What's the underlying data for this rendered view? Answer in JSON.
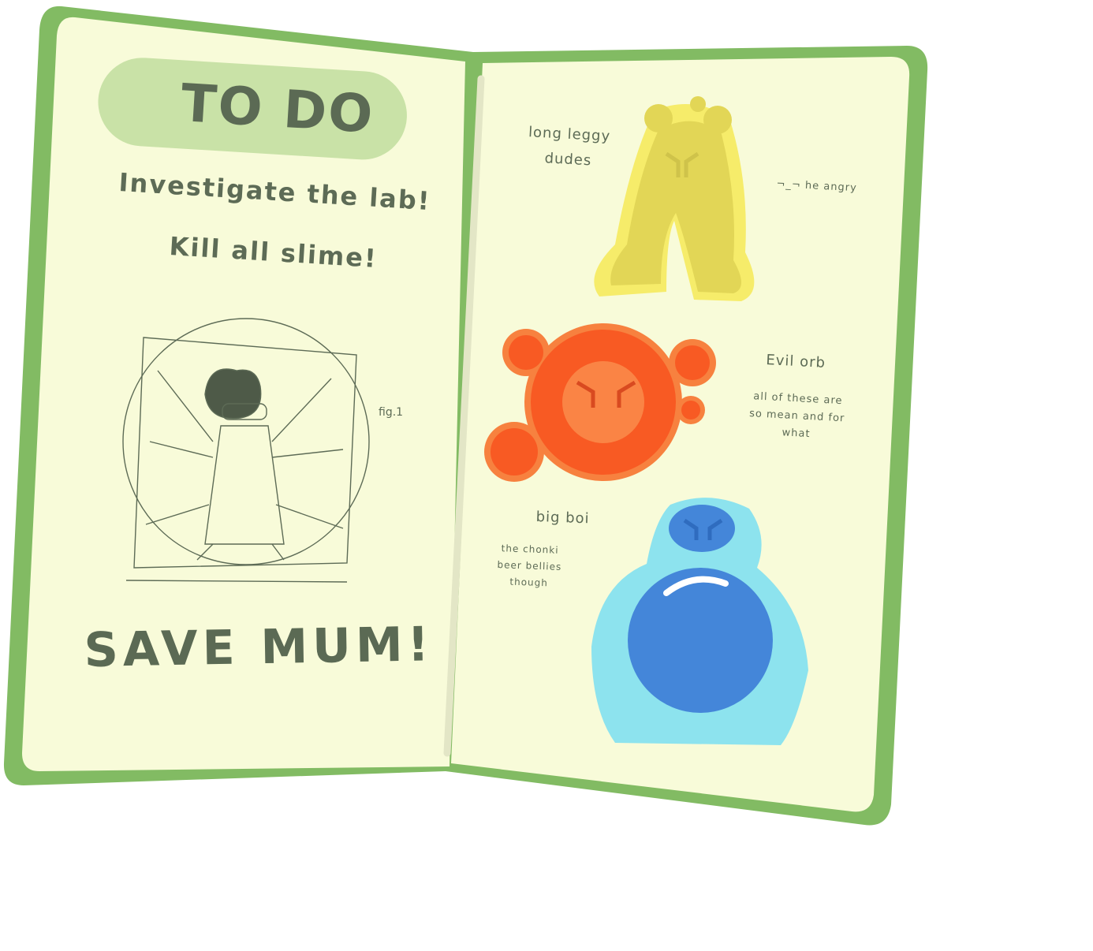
{
  "left_page": {
    "title": "TO DO",
    "tasks": [
      "Investigate the lab!",
      "Kill all slime!"
    ],
    "figure_label": "fig.1",
    "goal": "SAVE MUM!"
  },
  "right_page": {
    "slimes": [
      {
        "name": "long leggy dudes",
        "note": "¬_¬ he angry",
        "color": "#f4e55a"
      },
      {
        "name": "Evil orb",
        "note": "all of these are so mean and for what",
        "color": "#f85a23"
      },
      {
        "name": "big boi",
        "note": "the chonki beer bellies though",
        "color": "#8de3ee"
      }
    ]
  },
  "colors": {
    "cover": "#82bb63",
    "page": "#f8fbd9",
    "ink": "#5d6b56",
    "title_pill": "#c9e2a7"
  }
}
